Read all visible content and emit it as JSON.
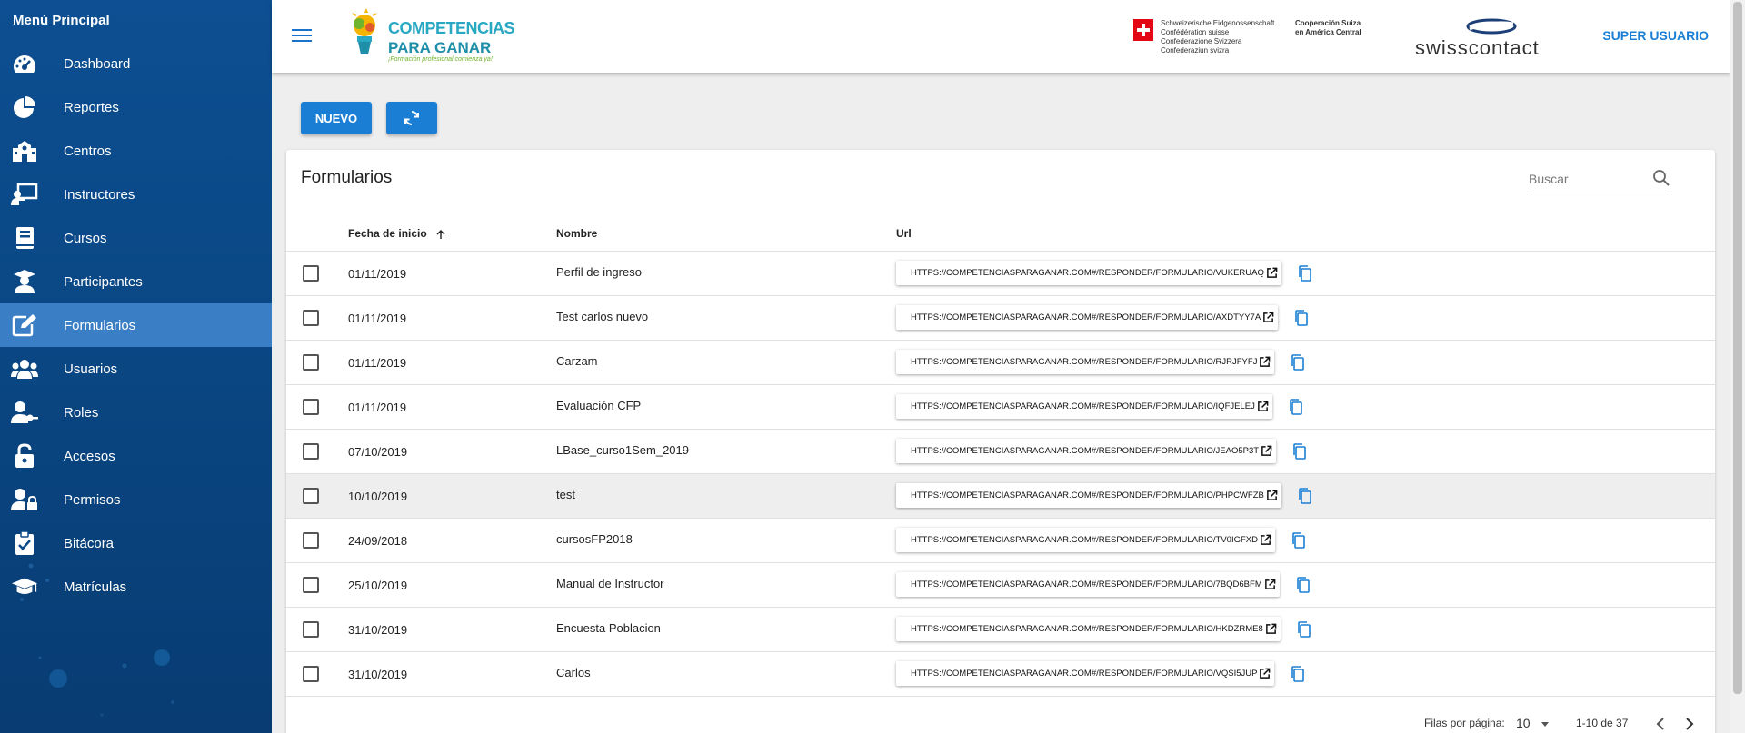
{
  "sidebar": {
    "title": "Menú Principal",
    "items": [
      {
        "label": "Dashboard",
        "icon": "speedometer-icon"
      },
      {
        "label": "Reportes",
        "icon": "pie-chart-icon"
      },
      {
        "label": "Centros",
        "icon": "school-building-icon"
      },
      {
        "label": "Instructores",
        "icon": "instructor-board-icon"
      },
      {
        "label": "Cursos",
        "icon": "book-icon"
      },
      {
        "label": "Participantes",
        "icon": "graduate-student-icon"
      },
      {
        "label": "Formularios",
        "icon": "edit-form-icon",
        "active": true
      },
      {
        "label": "Usuarios",
        "icon": "users-group-icon"
      },
      {
        "label": "Roles",
        "icon": "user-key-icon"
      },
      {
        "label": "Accesos",
        "icon": "unlock-icon"
      },
      {
        "label": "Permisos",
        "icon": "user-lock-icon"
      },
      {
        "label": "Bitácora",
        "icon": "clipboard-check-icon"
      },
      {
        "label": "Matrículas",
        "icon": "graduation-cap-icon"
      }
    ]
  },
  "header": {
    "logo_line1": "COMPETENCIAS",
    "logo_line2": "PARA GANAR",
    "logo_tagline": "¡Formación profesional comienza ya!",
    "confed_lines": [
      "Schweizerische Eidgenossenschaft",
      "Confédération suisse",
      "Confederazione Svizzera",
      "Confederaziun svizra"
    ],
    "coop_lines": [
      "Cooperación Suiza",
      "en América Central"
    ],
    "swisscontact": "swisscontact",
    "user": "SUPER USUARIO"
  },
  "toolbar": {
    "new_label": "NUEVO"
  },
  "card": {
    "title": "Formularios",
    "search_placeholder": "Buscar",
    "columns": {
      "fecha": "Fecha de inicio",
      "nombre": "Nombre",
      "url": "Url"
    },
    "rows": [
      {
        "fecha": "01/11/2019",
        "nombre": "Perfil de ingreso",
        "url": "HTTPS://COMPETENCIASPARAGANAR.COM#/RESPONDER/FORMULARIO/VUKERUAQ"
      },
      {
        "fecha": "01/11/2019",
        "nombre": "Test carlos nuevo",
        "url": "HTTPS://COMPETENCIASPARAGANAR.COM#/RESPONDER/FORMULARIO/AXDTYY7A"
      },
      {
        "fecha": "01/11/2019",
        "nombre": "Carzam",
        "url": "HTTPS://COMPETENCIASPARAGANAR.COM#/RESPONDER/FORMULARIO/RJRJFYFJ"
      },
      {
        "fecha": "01/11/2019",
        "nombre": "Evaluación CFP",
        "url": "HTTPS://COMPETENCIASPARAGANAR.COM#/RESPONDER/FORMULARIO/IQFJELEJ"
      },
      {
        "fecha": "07/10/2019",
        "nombre": "LBase_curso1Sem_2019",
        "url": "HTTPS://COMPETENCIASPARAGANAR.COM#/RESPONDER/FORMULARIO/JEAO5P3T"
      },
      {
        "fecha": "10/10/2019",
        "nombre": "test",
        "url": "HTTPS://COMPETENCIASPARAGANAR.COM#/RESPONDER/FORMULARIO/PHPCWFZB",
        "highlighted": true
      },
      {
        "fecha": "24/09/2018",
        "nombre": "cursosFP2018",
        "url": "HTTPS://COMPETENCIASPARAGANAR.COM#/RESPONDER/FORMULARIO/TV0IGFXD"
      },
      {
        "fecha": "25/10/2019",
        "nombre": "Manual de Instructor",
        "url": "HTTPS://COMPETENCIASPARAGANAR.COM#/RESPONDER/FORMULARIO/7BQD6BFM"
      },
      {
        "fecha": "31/10/2019",
        "nombre": "Encuesta Poblacion",
        "url": "HTTPS://COMPETENCIASPARAGANAR.COM#/RESPONDER/FORMULARIO/HKDZRME8"
      },
      {
        "fecha": "31/10/2019",
        "nombre": "Carlos",
        "url": "HTTPS://COMPETENCIASPARAGANAR.COM#/RESPONDER/FORMULARIO/VQSI5JUP"
      }
    ]
  },
  "pagination": {
    "rows_per_page_label": "Filas por página:",
    "rows_per_page": "10",
    "range": "1-10 de 37"
  },
  "colors": {
    "sidebar": "#0a4784",
    "active_item": "#3a7fc5",
    "accent": "#1a7fd4"
  }
}
